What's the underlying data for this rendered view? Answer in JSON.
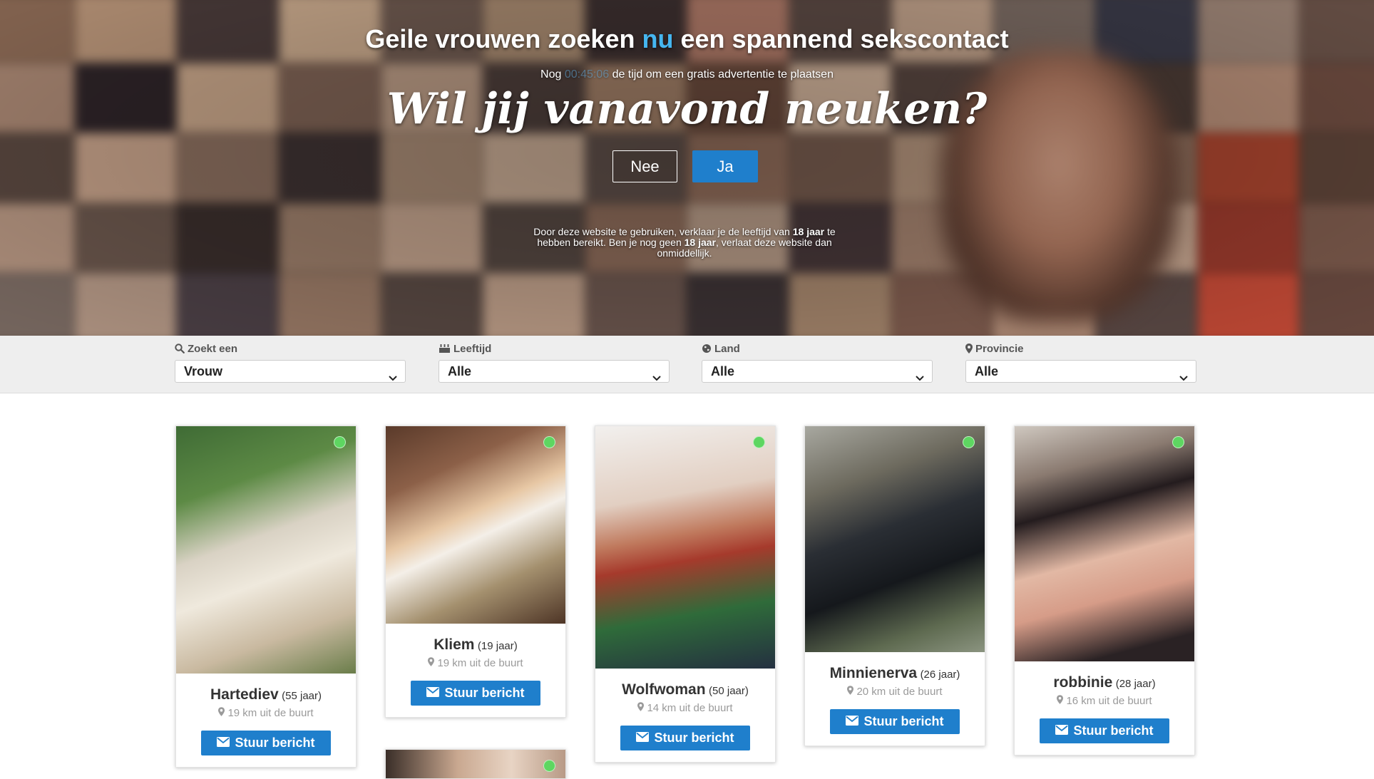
{
  "hero": {
    "title_part1": "Geile vrouwen zoeken",
    "title_accent": "nu",
    "title_part2": "een spannend sekscontact",
    "timer_prefix": "Nog",
    "timer_value": "00:45:06",
    "timer_suffix": "de tijd om een gratis advertentie te plaatsen",
    "question": "Wil jij vanavond neuken?",
    "no_label": "Nee",
    "yes_label": "Ja",
    "disclaimer_1": "Door deze website te gebruiken, verklaar je de leeftijd van",
    "disclaimer_age_1": "18 jaar",
    "disclaimer_2": "te hebben bereikt. Ben je nog geen",
    "disclaimer_age_2": "18 jaar",
    "disclaimer_3": ", verlaat deze website dan onmiddellijk."
  },
  "filters": [
    {
      "icon": "search-icon",
      "label": "Zoekt een",
      "value": "Vrouw"
    },
    {
      "icon": "group-icon",
      "label": "Leeftijd",
      "value": "Alle"
    },
    {
      "icon": "globe-icon",
      "label": "Land",
      "value": "Alle"
    },
    {
      "icon": "map-marker-icon",
      "label": "Provincie",
      "value": "Alle"
    }
  ],
  "profiles": [
    {
      "name": "Hartediev",
      "age": "(55 jaar)",
      "distance": "19 km uit de buurt",
      "button": "Stuur bericht",
      "online": true
    },
    {
      "name": "Kliem",
      "age": "(19 jaar)",
      "distance": "19 km uit de buurt",
      "button": "Stuur bericht",
      "online": true
    },
    {
      "name": "Wolfwoman",
      "age": "(50 jaar)",
      "distance": "14 km uit de buurt",
      "button": "Stuur bericht",
      "online": true
    },
    {
      "name": "Minnienerva",
      "age": "(26 jaar)",
      "distance": "20 km uit de buurt",
      "button": "Stuur bericht",
      "online": true
    },
    {
      "name": "robbinie",
      "age": "(28 jaar)",
      "distance": "16 km uit de buurt",
      "button": "Stuur bericht",
      "online": true
    }
  ],
  "colors": {
    "accent": "#45b6f0",
    "button_blue": "#1f7fcc",
    "online_dot": "#5ed661",
    "filter_bg": "#eeeeee"
  }
}
